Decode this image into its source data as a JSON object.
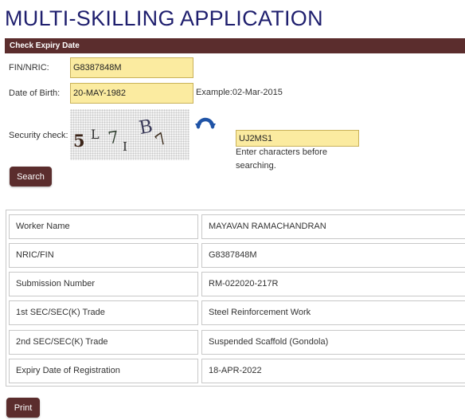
{
  "page": {
    "title": "MULTI-SKILLING APPLICATION"
  },
  "section": {
    "header": "Check Expiry Date"
  },
  "form": {
    "fin_label": "FIN/NRIC:",
    "fin_value": "G8387848M",
    "dob_label": "Date of Birth:",
    "dob_value": "20-MAY-1982",
    "dob_example": "Example:02-Mar-2015",
    "security_label": "Security check:",
    "captcha_chars": [
      "5",
      "L",
      "7",
      "I",
      "B",
      "7"
    ],
    "captcha_input_value": "UJ2MS1",
    "captcha_hint_line1": "Enter characters before",
    "captcha_hint_line2": "searching.",
    "search_label": "Search",
    "refresh_icon": "refresh-icon"
  },
  "results": {
    "rows": [
      {
        "key": "Worker Name",
        "value": "MAYAVAN RAMACHANDRAN"
      },
      {
        "key": "NRIC/FIN",
        "value": "G8387848M"
      },
      {
        "key": "Submission Number",
        "value": "RM-022020-217R"
      },
      {
        "key": "1st SEC/SEC(K) Trade",
        "value": "Steel Reinforcement Work"
      },
      {
        "key": "2nd SEC/SEC(K) Trade",
        "value": "Suspended Scaffold (Gondola)"
      },
      {
        "key": "Expiry Date of Registration",
        "value": "18-APR-2022"
      }
    ]
  },
  "actions": {
    "print_label": "Print"
  },
  "colors": {
    "title": "#1f1f6e",
    "accent": "#5b2d2d",
    "input_bg": "#fbeba0"
  }
}
